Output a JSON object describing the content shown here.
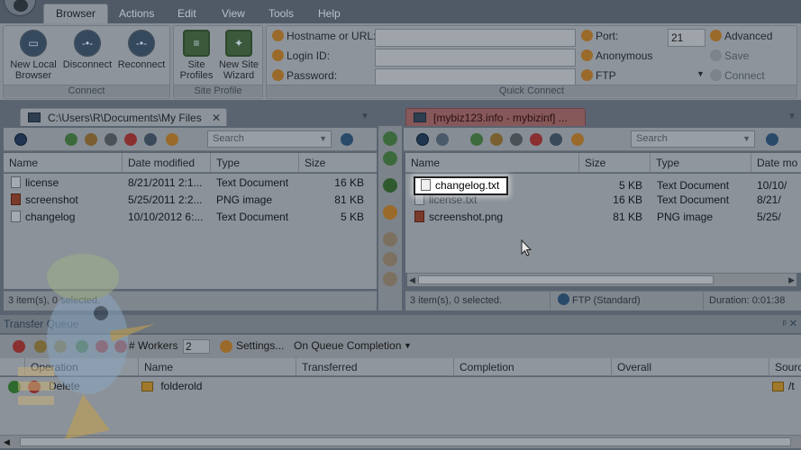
{
  "ribbon": {
    "tabs": [
      "Browser",
      "Actions",
      "Edit",
      "View",
      "Tools",
      "Help"
    ],
    "active_tab": "Browser",
    "connect_group": {
      "label": "Connect",
      "buttons": [
        {
          "label1": "New Local",
          "label2": "Browser",
          "icon": "monitor-icon"
        },
        {
          "label1": "Disconnect",
          "label2": "",
          "icon": "disconnect-icon"
        },
        {
          "label1": "Reconnect",
          "label2": "",
          "icon": "reconnect-icon"
        }
      ]
    },
    "site_profile_group": {
      "label": "Site Profile",
      "buttons": [
        {
          "label1": "Site",
          "label2": "Profiles",
          "icon": "site-profiles-icon"
        },
        {
          "label1": "New Site",
          "label2": "Wizard",
          "icon": "new-site-wizard-icon"
        }
      ]
    },
    "quick_connect": {
      "label": "Quick Connect",
      "hostname_label": "Hostname or URL:",
      "login_label": "Login ID:",
      "password_label": "Password:",
      "port_label": "Port:",
      "port_value": "21",
      "anonymous_label": "Anonymous",
      "protocol_label": "FTP",
      "advanced_label": "Advanced",
      "save_label": "Save",
      "connect_label": "Connect"
    }
  },
  "local_pane": {
    "tab_title": "C:\\Users\\R\\Documents\\My Files",
    "search_placeholder": "Search",
    "columns": [
      "Name",
      "Date modified",
      "Type",
      "Size"
    ],
    "rows": [
      {
        "name": "license",
        "date": "8/21/2011 2:1...",
        "type": "Text Document",
        "size": "16 KB",
        "icon": "text"
      },
      {
        "name": "screenshot",
        "date": "5/25/2011 2:2...",
        "type": "PNG image",
        "size": "81 KB",
        "icon": "img"
      },
      {
        "name": "changelog",
        "date": "10/10/2012 6:...",
        "type": "Text Document",
        "size": "5 KB",
        "icon": "text"
      }
    ],
    "status": "3 item(s), 0 selected."
  },
  "remote_pane": {
    "tab_title": "[mybiz123.info - mybizinf] ...",
    "search_placeholder": "Search",
    "columns": [
      "Name",
      "Size",
      "Type",
      "Date mo"
    ],
    "rows": [
      {
        "name": "changelog.txt",
        "size": "5 KB",
        "type": "Text Document",
        "date": "10/10/",
        "icon": "text"
      },
      {
        "name": "license.txt",
        "size": "16 KB",
        "type": "Text Document",
        "date": "8/21/",
        "icon": "text"
      },
      {
        "name": "screenshot.png",
        "size": "81 KB",
        "type": "PNG image",
        "date": "5/25/",
        "icon": "img"
      }
    ],
    "status": "3 item(s), 0 selected.",
    "protocol": "FTP (Standard)",
    "duration": "Duration: 0:01:38"
  },
  "transfer_queue": {
    "title": "Transfer Queue",
    "workers_label": "# Workers",
    "workers_value": "2",
    "settings_label": "Settings...",
    "on_completion_label": "On Queue Completion",
    "columns": [
      "Operation",
      "Name",
      "Transferred",
      "Completion",
      "Overall",
      "Sourc"
    ],
    "rows": [
      {
        "operation": "Delete",
        "name": "folderold",
        "source": "/t"
      }
    ]
  },
  "colors": {
    "accent_remote": "#86585a",
    "overlay": "#5a6470"
  }
}
